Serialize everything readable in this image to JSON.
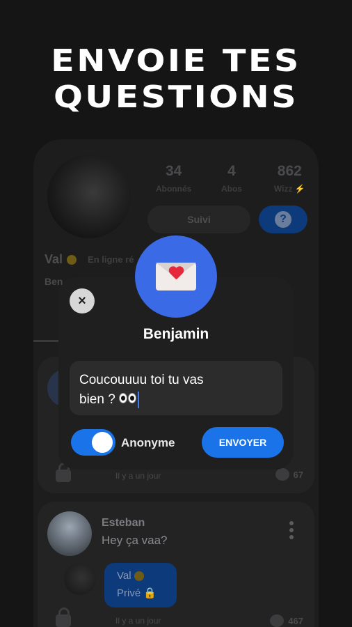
{
  "hero": {
    "line1": "ENVOIE TES",
    "line2": "QUESTIONS"
  },
  "profile": {
    "stats": [
      {
        "value": "34",
        "label": "Abonnés"
      },
      {
        "value": "4",
        "label": "Abos"
      },
      {
        "value": "862",
        "label": "Wizz ⚡"
      }
    ],
    "follow_label": "Suivi",
    "question_icon": "?",
    "name": "Val",
    "status": "En ligne ré",
    "bio": "Ben"
  },
  "feed": {
    "card1": {
      "time": "Il y a un jour",
      "replies": "67"
    },
    "card2": {
      "author": "Esteban",
      "message": "Hey ça vaa?",
      "reply_name": "Val",
      "reply_status": "Privé",
      "time": "Il y a un jour",
      "replies": "467"
    }
  },
  "modal": {
    "recipient": "Benjamin",
    "message_line1": "Coucouuuu toi tu vas",
    "message_line2": "bien ?",
    "anonymous_label": "Anonyme",
    "anonymous_on": true,
    "send_label": "ENVOYER",
    "close_icon": "×"
  },
  "colors": {
    "accent": "#1a73e8",
    "envelope_circle": "#3b6ae6",
    "background": "#151515"
  }
}
